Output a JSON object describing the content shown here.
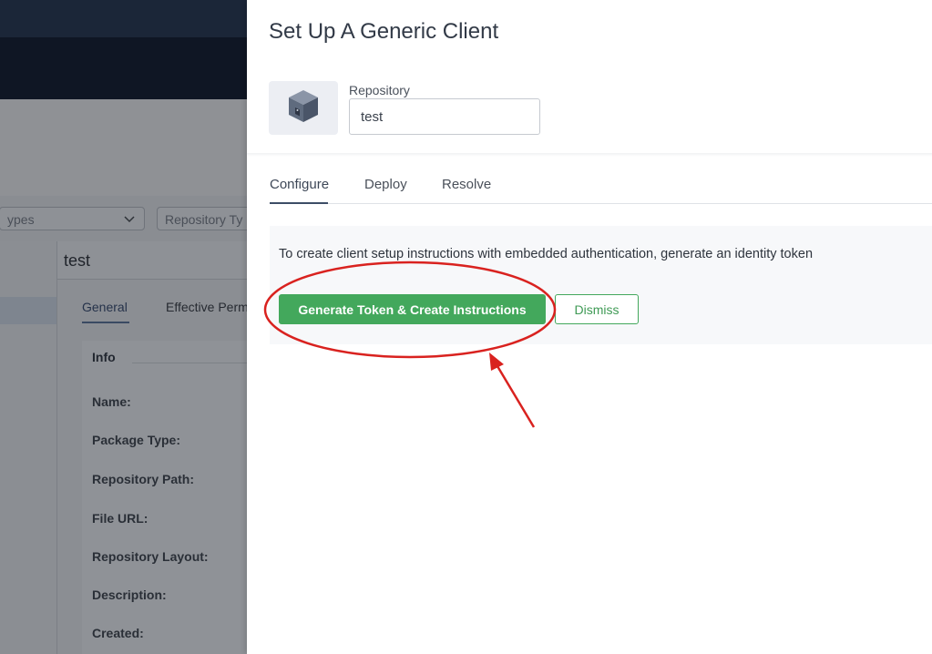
{
  "background": {
    "filter_types_text": "ypes",
    "filter_repo_type_text": "Repository Ty",
    "selected_repo_title": "test",
    "tabs": [
      "General",
      "Effective Perm"
    ],
    "info_title": "Info",
    "fields": [
      "Name:",
      "Package Type:",
      "Repository Path:",
      "File URL:",
      "Repository Layout:",
      "Description:",
      "Created:"
    ]
  },
  "drawer": {
    "title": "Set Up A Generic Client",
    "repository_label": "Repository",
    "repository_value": "test",
    "repository_icon": "package-box-icon",
    "tabs": [
      {
        "label": "Configure",
        "active": true
      },
      {
        "label": "Deploy",
        "active": false
      },
      {
        "label": "Resolve",
        "active": false
      }
    ],
    "notice": {
      "text": "To create client setup instructions with embedded authentication, generate an identity token",
      "primary_button": "Generate Token & Create Instructions",
      "secondary_button": "Dismiss"
    }
  },
  "colors": {
    "accent_green": "#43a85c",
    "annotation_red": "#d9221f",
    "header_dark": "#1b2638"
  }
}
